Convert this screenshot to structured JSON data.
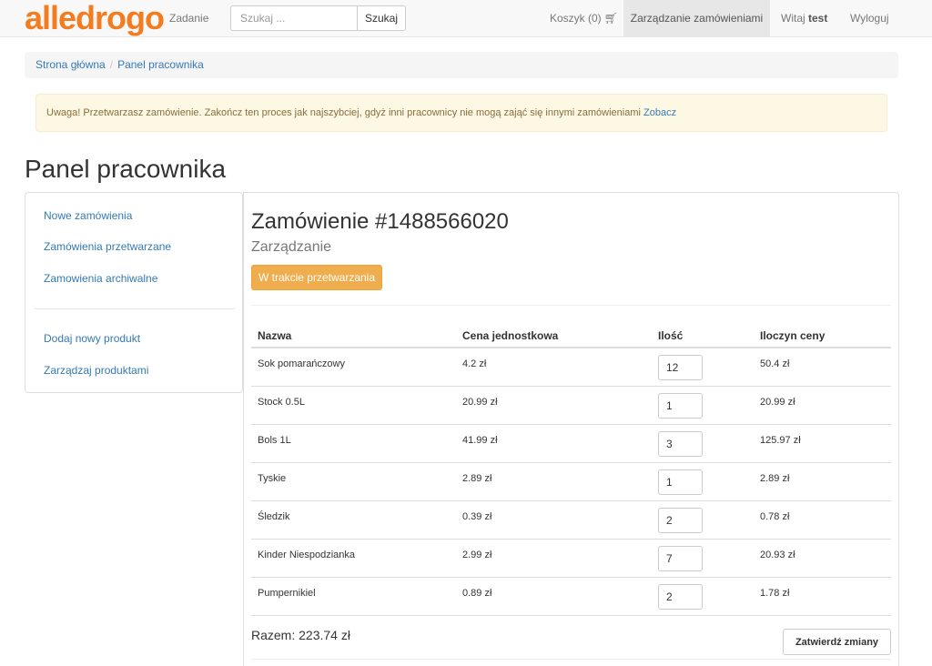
{
  "navbar": {
    "brand": "alledrogo",
    "task_label": "Zadanie",
    "search_placeholder": "Szukaj ...",
    "search_button": "Szukaj",
    "cart_label": "Koszyk (0)",
    "cart_icon": "shopping-cart-icon",
    "manage_orders": "Zarządzanie zamówieniami",
    "welcome_prefix": "Witaj",
    "username": "test",
    "logout": "Wyloguj"
  },
  "breadcrumb": {
    "home": "Strona główna",
    "separator": "/",
    "current": "Panel pracownika"
  },
  "alert": {
    "message": "Uwaga! Przetwarzasz zamówienie. Zakończ ten proces jak najszybciej, gdyż inni pracownicy nie mogą zająć się innymi zamówieniami",
    "link": "Zobacz"
  },
  "page": {
    "title": "Panel pracownika"
  },
  "sidebar": {
    "items": [
      {
        "label": "Nowe zamówienia"
      },
      {
        "label": "Zamówienia przetwarzane"
      },
      {
        "label": "Zamowienia archiwalne"
      },
      {
        "label": "Dodaj nowy produkt"
      },
      {
        "label": "Zarządzaj produktami"
      }
    ]
  },
  "order": {
    "title": "Zamówienie #1488566020",
    "subtitle": "Zarządzanie",
    "status_button": "W trakcie przetwarzania",
    "columns": [
      "Nazwa",
      "Cena jednostkowa",
      "Ilość",
      "Iloczyn ceny"
    ],
    "rows": [
      {
        "name": "Sok pomarańczowy",
        "price": "4.2 zł",
        "qty": "12",
        "total": "50.4 zł"
      },
      {
        "name": "Stock 0.5L",
        "price": "20.99 zł",
        "qty": "1",
        "total": "20.99 zł"
      },
      {
        "name": "Bols 1L",
        "price": "41.99 zł",
        "qty": "3",
        "total": "125.97 zł"
      },
      {
        "name": "Tyskie",
        "price": "2.89 zł",
        "qty": "1",
        "total": "2.89 zł"
      },
      {
        "name": "Śledzik",
        "price": "0.39 zł",
        "qty": "2",
        "total": "0.78 zł"
      },
      {
        "name": "Kinder Niespodzianka",
        "price": "2.99 zł",
        "qty": "7",
        "total": "20.93 zł"
      },
      {
        "name": "Pumpernikiel",
        "price": "0.89 zł",
        "qty": "2",
        "total": "1.78 zł"
      }
    ],
    "sum_label": "Razem: 223.74 zł",
    "confirm_button": "Zatwierdź zmiany"
  },
  "colors": {
    "brand": "#f47c20",
    "link": "#337ab7",
    "warning_button": "#f0ad4e",
    "alert_bg": "#fcf8e3",
    "alert_text": "#8a6d3b"
  }
}
